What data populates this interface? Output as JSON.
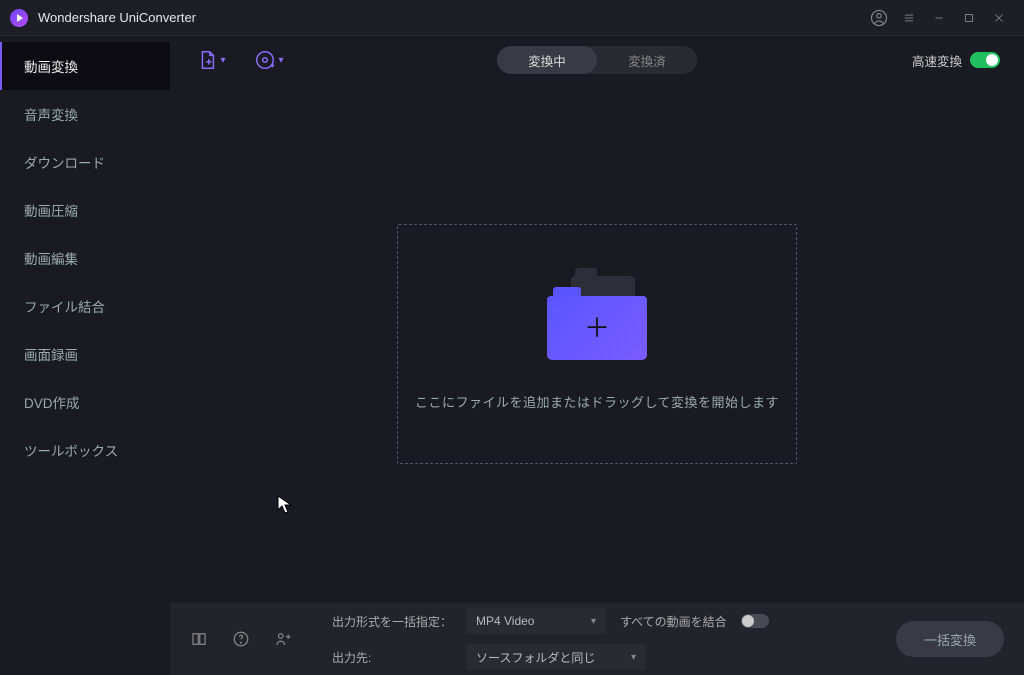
{
  "app": {
    "title": "Wondershare UniConverter"
  },
  "sidebar": {
    "items": [
      {
        "label": "動画変換"
      },
      {
        "label": "音声変換"
      },
      {
        "label": "ダウンロード"
      },
      {
        "label": "動画圧縮"
      },
      {
        "label": "動画編集"
      },
      {
        "label": "ファイル結合"
      },
      {
        "label": "画面録画"
      },
      {
        "label": "DVD作成"
      },
      {
        "label": "ツールボックス"
      }
    ],
    "active_index": 0
  },
  "toolbar": {
    "tabs": {
      "converting": "変換中",
      "converted": "変換済",
      "active": "converting"
    },
    "speed_label": "高速変換"
  },
  "dropzone": {
    "text": "ここにファイルを追加またはドラッグして変換を開始します"
  },
  "bottom": {
    "format_label": "出力形式を一括指定：",
    "format_value": "MP4 Video",
    "dest_label": "出力先:",
    "dest_value": "ソースフォルダと同じ",
    "merge_label": "すべての動画を結合",
    "merge_on": false,
    "convert_btn": "一括変換"
  }
}
